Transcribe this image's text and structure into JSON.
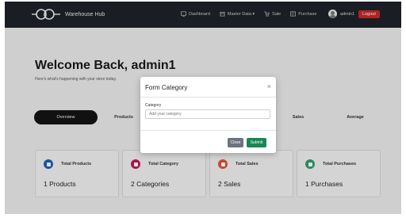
{
  "navbar": {
    "brand": "Warehouse Hub",
    "links": [
      {
        "label": "Dashboard",
        "icon": "dashboard-icon"
      },
      {
        "label": "Master Data ▾",
        "icon": "box-icon"
      },
      {
        "label": "Sale",
        "icon": "cart-icon"
      },
      {
        "label": "Purchase",
        "icon": "receipt-icon"
      }
    ],
    "user": "admin1",
    "logout_label": "Logout"
  },
  "main": {
    "welcome": "Welcome Back, admin1",
    "subtitle": "Here's what's happening with your store today."
  },
  "tabs": [
    {
      "label": "Overview",
      "active": true
    },
    {
      "label": "Products",
      "active": false
    },
    {
      "label": "Sales",
      "active": false
    },
    {
      "label": "Average",
      "active": false
    }
  ],
  "cards": [
    {
      "title": "Total Products",
      "value": "1 Products",
      "color": "#1e5fb3"
    },
    {
      "title": "Total Category",
      "value": "2 Categories",
      "color": "#c2185b"
    },
    {
      "title": "Total Sales",
      "value": "2 Sales",
      "color": "#e0553a"
    },
    {
      "title": "Total Purchases",
      "value": "1 Purchases",
      "color": "#2e9e6b"
    }
  ],
  "modal": {
    "title": "Form Category",
    "close_icon": "×",
    "field_label": "Category",
    "field_placeholder": "Add your category",
    "field_value": "",
    "close_button": "Close",
    "submit_button": "Submit"
  },
  "colors": {
    "navbar_bg": "#1e2228",
    "logout_bg": "#c62828",
    "submit_bg": "#198754",
    "close_bg": "#6c757d"
  }
}
